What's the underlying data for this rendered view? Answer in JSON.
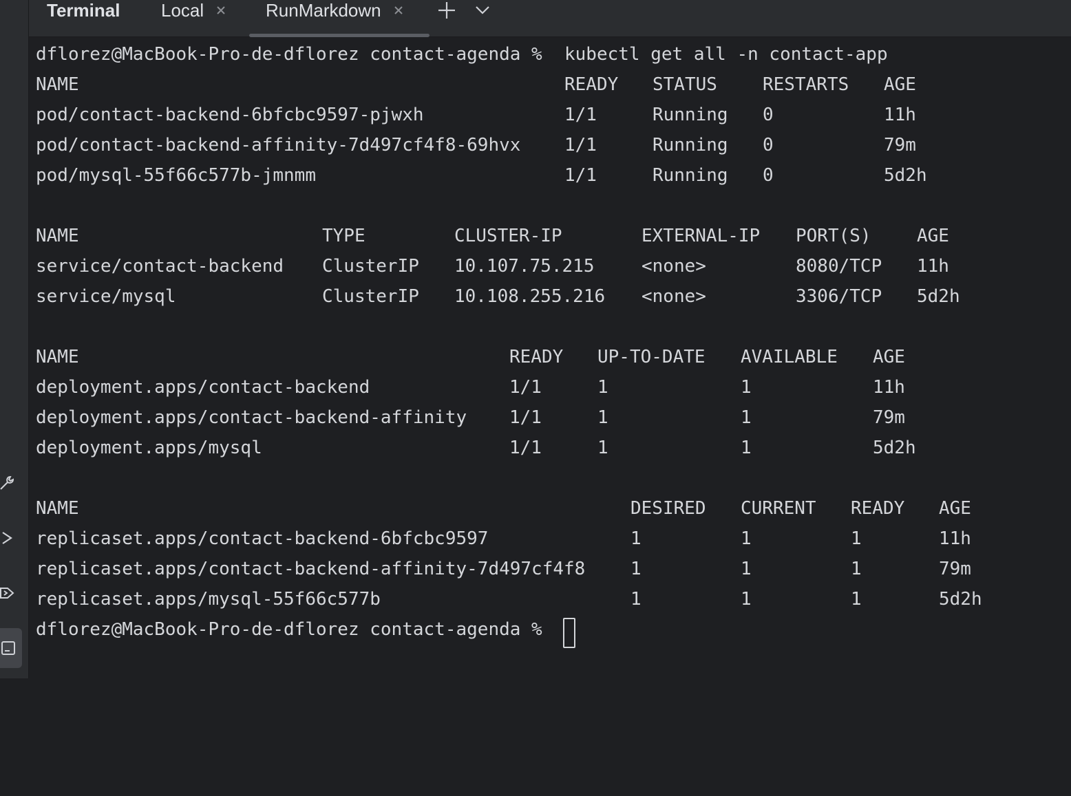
{
  "tabs": {
    "title": "Terminal",
    "items": [
      {
        "label": "Local"
      },
      {
        "label": "RunMarkdown"
      }
    ]
  },
  "terminal": {
    "prompt_user": "dflorez@MacBook-Pro-de-dflorez contact-agenda %",
    "command": "kubectl get all -n contact-app",
    "pods": {
      "headers": [
        "NAME",
        "READY",
        "STATUS",
        "RESTARTS",
        "AGE"
      ],
      "rows": [
        [
          "pod/contact-backend-6bfcbc9597-pjwxh",
          "1/1",
          "Running",
          "0",
          "11h"
        ],
        [
          "pod/contact-backend-affinity-7d497cf4f8-69hvx",
          "1/1",
          "Running",
          "0",
          "79m"
        ],
        [
          "pod/mysql-55f66c577b-jmnmm",
          "1/1",
          "Running",
          "0",
          "5d2h"
        ]
      ]
    },
    "services": {
      "headers": [
        "NAME",
        "TYPE",
        "CLUSTER-IP",
        "EXTERNAL-IP",
        "PORT(S)",
        "AGE"
      ],
      "rows": [
        [
          "service/contact-backend",
          "ClusterIP",
          "10.107.75.215",
          "<none>",
          "8080/TCP",
          "11h"
        ],
        [
          "service/mysql",
          "ClusterIP",
          "10.108.255.216",
          "<none>",
          "3306/TCP",
          "5d2h"
        ]
      ]
    },
    "deployments": {
      "headers": [
        "NAME",
        "READY",
        "UP-TO-DATE",
        "AVAILABLE",
        "AGE"
      ],
      "rows": [
        [
          "deployment.apps/contact-backend",
          "1/1",
          "1",
          "1",
          "11h"
        ],
        [
          "deployment.apps/contact-backend-affinity",
          "1/1",
          "1",
          "1",
          "79m"
        ],
        [
          "deployment.apps/mysql",
          "1/1",
          "1",
          "1",
          "5d2h"
        ]
      ]
    },
    "replicasets": {
      "headers": [
        "NAME",
        "DESIRED",
        "CURRENT",
        "READY",
        "AGE"
      ],
      "rows": [
        [
          "replicaset.apps/contact-backend-6bfcbc9597",
          "1",
          "1",
          "1",
          "11h"
        ],
        [
          "replicaset.apps/contact-backend-affinity-7d497cf4f8",
          "1",
          "1",
          "1",
          "79m"
        ],
        [
          "replicaset.apps/mysql-55f66c577b",
          "1",
          "1",
          "1",
          "5d2h"
        ]
      ]
    },
    "final_prompt": "dflorez@MacBook-Pro-de-dflorez contact-agenda %"
  }
}
